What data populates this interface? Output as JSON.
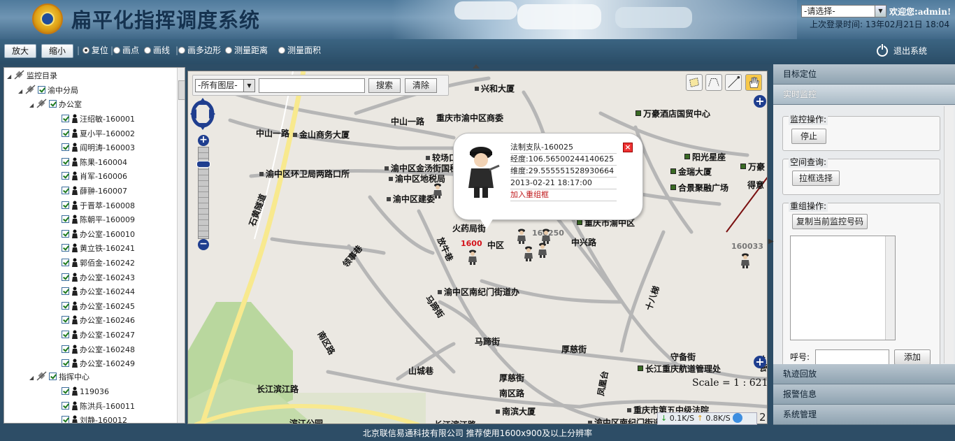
{
  "header": {
    "title": "扁平化指挥调度系统",
    "role_select": "-请选择-",
    "welcome_prefix": "欢迎您:",
    "user": "admin!",
    "last_login_label": "上次登录时间:",
    "last_login_value": "13年02月21日 18:04"
  },
  "toolbar": {
    "zoom_in": "放大",
    "zoom_out": "缩小",
    "tools": [
      "复位",
      "画点",
      "画线",
      "画多边形",
      "测量距离",
      "测量面积"
    ],
    "selected_tool": "复位",
    "logout": "退出系统"
  },
  "tree": {
    "root": "监控目录",
    "branch1": "渝中分局",
    "branch1_sub": "办公室",
    "members1": [
      "汪绍敏-160001",
      "夏小平-160002",
      "阎明涛-160003",
      "陈果-160004",
      "肖军-160006",
      "薛翀-160007",
      "于晋萃-160008",
      "陈朝平-160009",
      "办公室-160010",
      "黄立铁-160241",
      "郭佰金-160242",
      "办公室-160243",
      "办公室-160244",
      "办公室-160245",
      "办公室-160246",
      "办公室-160247",
      "办公室-160248",
      "办公室-160249"
    ],
    "branch2": "指挥中心",
    "members2": [
      "119036",
      "陈洪兵-160011",
      "刘静-160012"
    ]
  },
  "map": {
    "layer_select": "-所有图层-",
    "search_value": "",
    "search_button": "搜索",
    "clear_button": "清除",
    "labels": [
      "兴和大厦",
      "中山一路",
      "重庆市渝中区商委",
      "中山一路",
      "金山商务大厦",
      "较场口",
      "渝中区环卫局两路口所",
      "渝中区金汤街国税",
      "渝中区地税局",
      "渝中区建委",
      "石黄隧道",
      "火药局街",
      "1600",
      "中区",
      "160250",
      "中兴路",
      "领事巷",
      "放牛巷",
      "渝中区南纪门街道办",
      "马蹄街",
      "马蹄街",
      "南区路",
      "山城巷",
      "厚慈街",
      "厚慈街",
      "长江滨江路",
      "南区路",
      "南滨大厦",
      "滨江公园",
      "长江滨江路",
      "凤凰台",
      "守备街",
      "长江重庆航道管理处",
      "十八梯",
      "重庆市第五中级法院",
      "渝中区南纪门街道",
      "万豪酒店国贸中心",
      "阳光星座",
      "金瑞大厦",
      "合景聚融广场",
      "万豪",
      "得意",
      "160033",
      "重庆市渝中区",
      "花街"
    ],
    "scale": "Scale = 1 : 621",
    "net_down": "0.1K/S",
    "net_up": "0.8K/S",
    "corner_num": "2"
  },
  "popup": {
    "name": "法制支队-160025",
    "longitude": "经度:106.56500244140625",
    "latitude": "维度:29.555551528930664",
    "time": "2013-02-21 18:17:00",
    "action": "加入重组框",
    "close": "×"
  },
  "rpanel": {
    "sections": [
      "目标定位",
      "实时监控",
      "轨迹回放",
      "报警信息",
      "系统管理"
    ],
    "active": "实时监控",
    "monitor_label": "监控操作:",
    "stop_button": "停止",
    "spatial_label": "空间查询:",
    "box_select_button": "拉框选择",
    "regroup_label": "重组操作:",
    "copy_button": "复制当前监控号码",
    "textarea_value": "",
    "callsign_label": "呼号:",
    "callsign_value": "",
    "add_button": "添加"
  },
  "footer": {
    "text": "北京联信易通科技有限公司    推荐使用1600x900及以上分辨率"
  },
  "colors": {
    "header_bg": "#4f7a9c",
    "toolbar_bg": "#2f5571",
    "accordion": "#9fb1be",
    "map_bg": "#ebe8e2",
    "zoom": "#1f3e8f"
  }
}
